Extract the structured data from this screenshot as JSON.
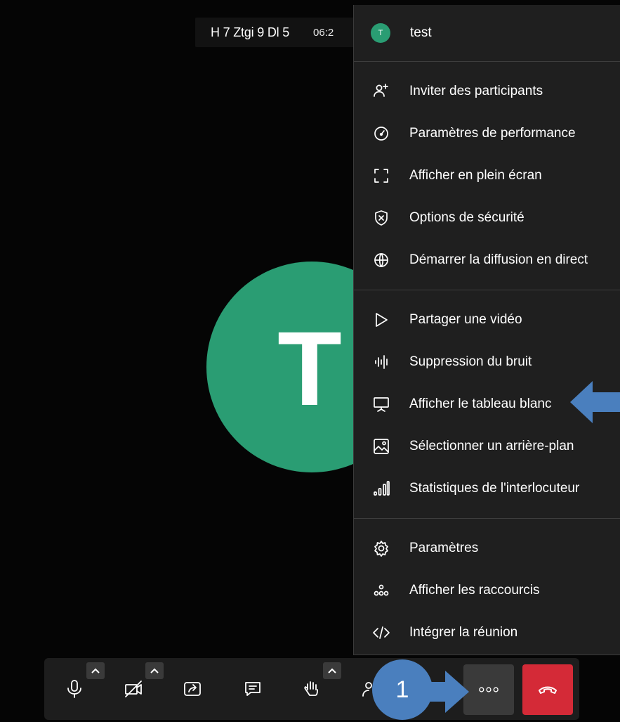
{
  "header": {
    "meeting_title": "H 7 Ztgi 9 Dl 5",
    "elapsed_time": "06:2"
  },
  "participant": {
    "initial": "T"
  },
  "menu": {
    "user": {
      "initial": "T",
      "name": "test"
    },
    "items": [
      {
        "label": "Inviter des participants",
        "icon": "invite-people-icon"
      },
      {
        "label": "Paramètres de performance",
        "icon": "performance-gauge-icon"
      },
      {
        "label": "Afficher en plein écran",
        "icon": "fullscreen-icon"
      },
      {
        "label": "Options de sécurité",
        "icon": "security-shield-icon"
      },
      {
        "label": "Démarrer la diffusion en direct",
        "icon": "globe-icon"
      },
      {
        "label": "Partager une vidéo",
        "icon": "play-icon"
      },
      {
        "label": "Suppression du bruit",
        "icon": "noise-suppression-icon"
      },
      {
        "label": "Afficher le tableau blanc",
        "icon": "whiteboard-icon"
      },
      {
        "label": "Sélectionner un arrière-plan",
        "icon": "background-image-icon"
      },
      {
        "label": "Statistiques de l'interlocuteur",
        "icon": "stats-bars-icon"
      },
      {
        "label": "Paramètres",
        "icon": "gear-icon"
      },
      {
        "label": "Afficher les raccourcis",
        "icon": "shortcuts-icon"
      },
      {
        "label": "Intégrer la réunion",
        "icon": "embed-code-icon"
      }
    ]
  },
  "toolbar": {
    "buttons": [
      "microphone-icon",
      "camera-off-icon",
      "screen-share-icon",
      "chat-icon",
      "raise-hand-icon",
      "participants-icon",
      "more-options-icon",
      "hangup-icon"
    ]
  },
  "annotations": {
    "step_number": "1"
  },
  "colors": {
    "avatar_green": "#2a9d73",
    "menu_bg": "#1f1f1f",
    "hangup_red": "#d42a37",
    "annotation_blue": "#4a7fbe"
  }
}
